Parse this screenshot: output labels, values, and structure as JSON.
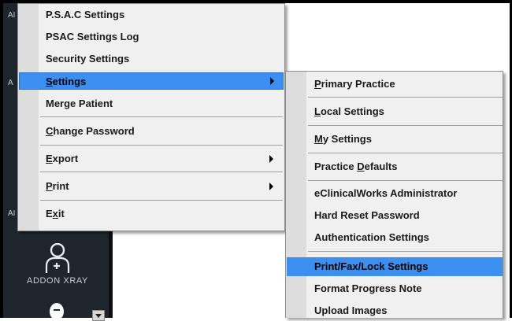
{
  "colors": {
    "sidebar_bg": "#1f252c",
    "menu_bg": "#f0f0f0",
    "menu_gutter": "#dddddd",
    "highlight": "#3b8ff0"
  },
  "sidebar": {
    "fragments": [
      "AI",
      "A",
      "AI"
    ],
    "addon_label": "ADDON XRAY",
    "addon_icon": "doctor-plus-icon",
    "bottom_icon": "user-silhouette-icon"
  },
  "main_menu": {
    "items": [
      {
        "label": "P.S.A.C Settings"
      },
      {
        "label": "PSAC Settings Log"
      },
      {
        "label": "Security Settings"
      },
      {
        "mn": "S",
        "rest": "ettings",
        "submenu": true,
        "highlighted": true
      },
      {
        "label": "Merge Patient"
      },
      {
        "mn": "C",
        "rest": "hange Password"
      },
      {
        "mn": "E",
        "rest": "xport",
        "submenu": true
      },
      {
        "mn": "P",
        "rest": "rint",
        "submenu": true
      },
      {
        "pre": "E",
        "mn": "x",
        "rest": "it"
      }
    ]
  },
  "submenu": {
    "items": [
      {
        "mn": "P",
        "rest": "rimary Practice"
      },
      {
        "mn": "L",
        "rest": "ocal Settings"
      },
      {
        "mn": "M",
        "rest": "y Settings"
      },
      {
        "pre": "Practice ",
        "mn": "D",
        "rest": "efaults"
      },
      {
        "label": "eClinicalWorks Administrator"
      },
      {
        "label": "Hard Reset Password"
      },
      {
        "label": "Authentication Settings"
      },
      {
        "label": "Print/Fax/Lock Settings",
        "highlighted": true
      },
      {
        "label": "Format Progress Note"
      },
      {
        "label": "Upload Images"
      }
    ]
  }
}
